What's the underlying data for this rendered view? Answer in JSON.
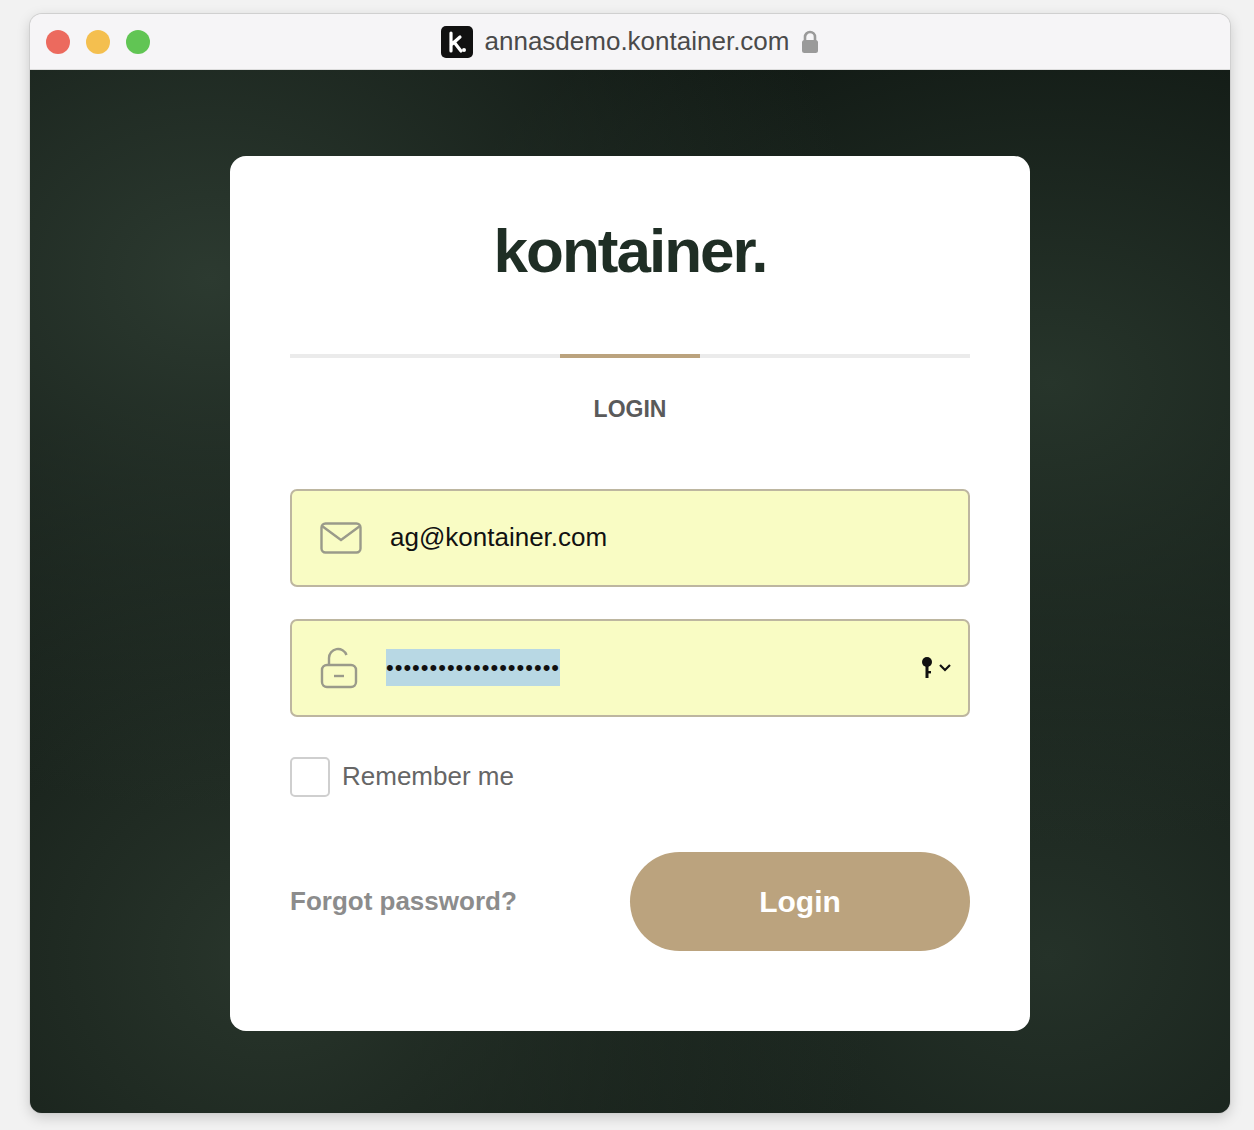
{
  "window": {
    "url": "annasdemo.kontainer.com"
  },
  "logo": "kontainer.",
  "tabs": [
    {
      "label": "LOGIN",
      "selected": true
    }
  ],
  "email": {
    "value": "ag@kontainer.com"
  },
  "password": {
    "value": "••••••••••••••••••••",
    "highlighted": true
  },
  "remember_me": {
    "label": "Remember me",
    "checked": false
  },
  "forgot_password": "Forgot password?",
  "login_button": "Login"
}
